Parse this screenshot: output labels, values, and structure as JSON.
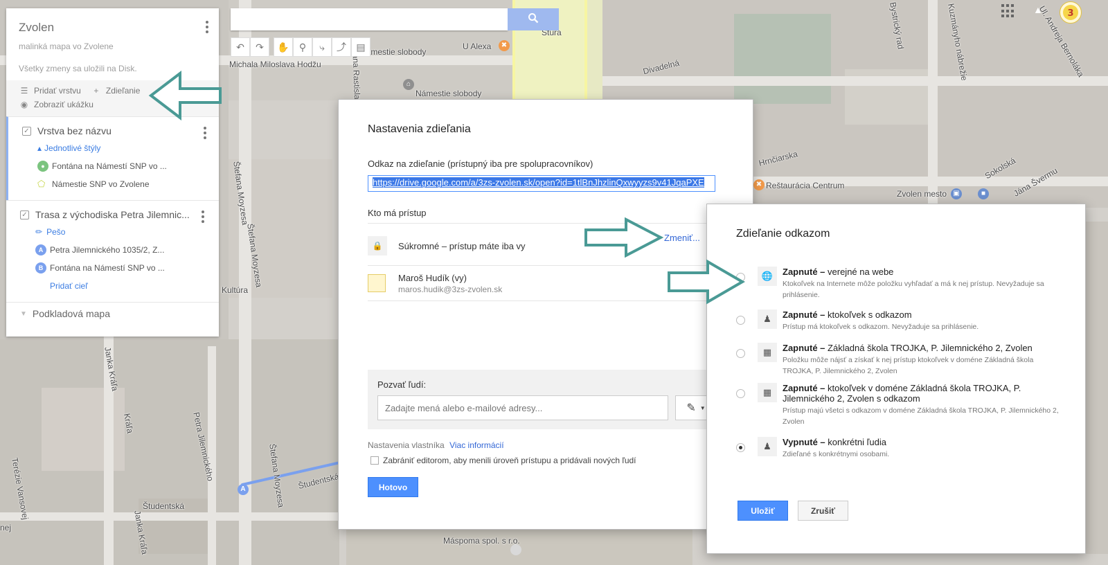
{
  "map": {
    "labels": [
      "Michala Miloslava Hodžu",
      "Námestie slobody",
      "Námestie slobody",
      "U Alexa",
      "Divadelná",
      "Hrnčiarska",
      "Reštaurácia Centrum",
      "Zvolen mesto",
      "Sokolská",
      "Jána Švermu",
      "Bystrický rad",
      "Kuzmányho nábrežie",
      "Ul. Andreja Bernoláka",
      "Štefana Moyzesa",
      "Štefana Moyzesa",
      "Štefana Moyzesa",
      "Milana Rastislava Štefánika",
      "Petra Jilemnického",
      "Študentská",
      "Janka Kráľa",
      "Janka Kráľa",
      "Terézie Vansovej",
      "Máspoma spol. s r.o.",
      "Študentská",
      "Kultúra",
      "Štúra",
      "nej",
      "Kráľa"
    ],
    "route_start_marker": "A"
  },
  "search": {
    "placeholder": "",
    "button_icon": "search-icon"
  },
  "toolbar": {
    "tools": [
      "undo-icon",
      "redo-icon",
      "hand-icon",
      "marker-icon",
      "line-icon",
      "directions-icon",
      "ruler-icon"
    ]
  },
  "topbar": {
    "apps_icon": "apps-icon",
    "notifications_icon": "bell-icon"
  },
  "left_panel": {
    "title": "Zvolen",
    "description": "malinká mapa vo Zvolene",
    "save_status": "Všetky zmeny sa uložili na Disk.",
    "add_layer_label": "Pridať vrstvu",
    "share_label": "Zdieľanie",
    "preview_label": "Zobraziť ukážku",
    "layers": [
      {
        "name": "Vrstva bez názvu",
        "style_link": "Jednotlivé štýly",
        "items": [
          "Fontána na Námestí SNP vo ...",
          "Námestie SNP vo Zvolene"
        ]
      },
      {
        "name": "Trasa z východiska Petra Jilemnic...",
        "mode": "Pešo",
        "points": [
          {
            "marker": "A",
            "label": "Petra Jilemnického 1035/2, Z..."
          },
          {
            "marker": "B",
            "label": "Fontána na Námestí SNP vo ..."
          }
        ],
        "add_destination": "Pridať cieľ"
      }
    ],
    "base_map_label": "Podkladová mapa"
  },
  "share_dialog": {
    "title": "Nastavenia zdieľania",
    "link_label": "Odkaz na zdieľanie (prístupný iba pre spolupracovníkov)",
    "link_value": "https://drive.google.com/a/3zs-zvolen.sk/open?id=1tlBnJhzlinQxwyyzs9v41JqaPXE",
    "access_label": "Kto má prístup",
    "private_text": "Súkromné – prístup máte iba vy",
    "change_link": "Zmeniť...",
    "user_name": "Maroš Hudík (vy)",
    "user_email": "maros.hudik@3zs-zvolen.sk",
    "invite_label": "Pozvať ľudí:",
    "invite_placeholder": "Zadajte mená alebo e-mailové adresy...",
    "owner_settings": "Nastavenia vlastníka",
    "more_info": "Viac informácií",
    "prevent_editors": "Zabrániť editorom, aby menili úroveň prístupu a pridávali nových ľudí",
    "done_button": "Hotovo"
  },
  "link_dialog": {
    "title": "Zdieľanie odkazom",
    "options": [
      {
        "bold": "Zapnuté –",
        "rest": " verejné na webe",
        "desc": "Ktokoľvek na Internete môže položku vyhľadať a má k nej prístup. Nevyžaduje sa prihlásenie.",
        "icon": "globe-icon",
        "selected": false
      },
      {
        "bold": "Zapnuté –",
        "rest": " ktokoľvek s odkazom",
        "desc": "Prístup má ktokoľvek s odkazom. Nevyžaduje sa prihlásenie.",
        "icon": "person-link-icon",
        "selected": false
      },
      {
        "bold": "Zapnuté –",
        "rest": " Základná škola TROJKA, P. Jilemnického 2, Zvolen",
        "desc": "Položku môže nájsť a získať k nej prístup ktokoľvek v doméne Základná škola TROJKA, P. Jilemnického 2, Zvolen",
        "icon": "building-icon",
        "selected": false
      },
      {
        "bold": "Zapnuté –",
        "rest": " ktokoľvek v doméne Základná škola TROJKA, P. Jilemnického 2, Zvolen s odkazom",
        "desc": "Prístup majú všetci s odkazom v doméne Základná škola TROJKA, P. Jilemnického 2, Zvolen",
        "icon": "building-link-icon",
        "selected": false
      },
      {
        "bold": "Vypnuté –",
        "rest": " konkrétni ľudia",
        "desc": "Zdieľané s konkrétnymi osobami.",
        "icon": "person-icon",
        "selected": true
      }
    ],
    "save_button": "Uložiť",
    "cancel_button": "Zrušiť"
  },
  "colors": {
    "teal_arrow": "#4a9a95",
    "primary_blue": "#4d90fe",
    "link_blue": "#3367d6"
  }
}
